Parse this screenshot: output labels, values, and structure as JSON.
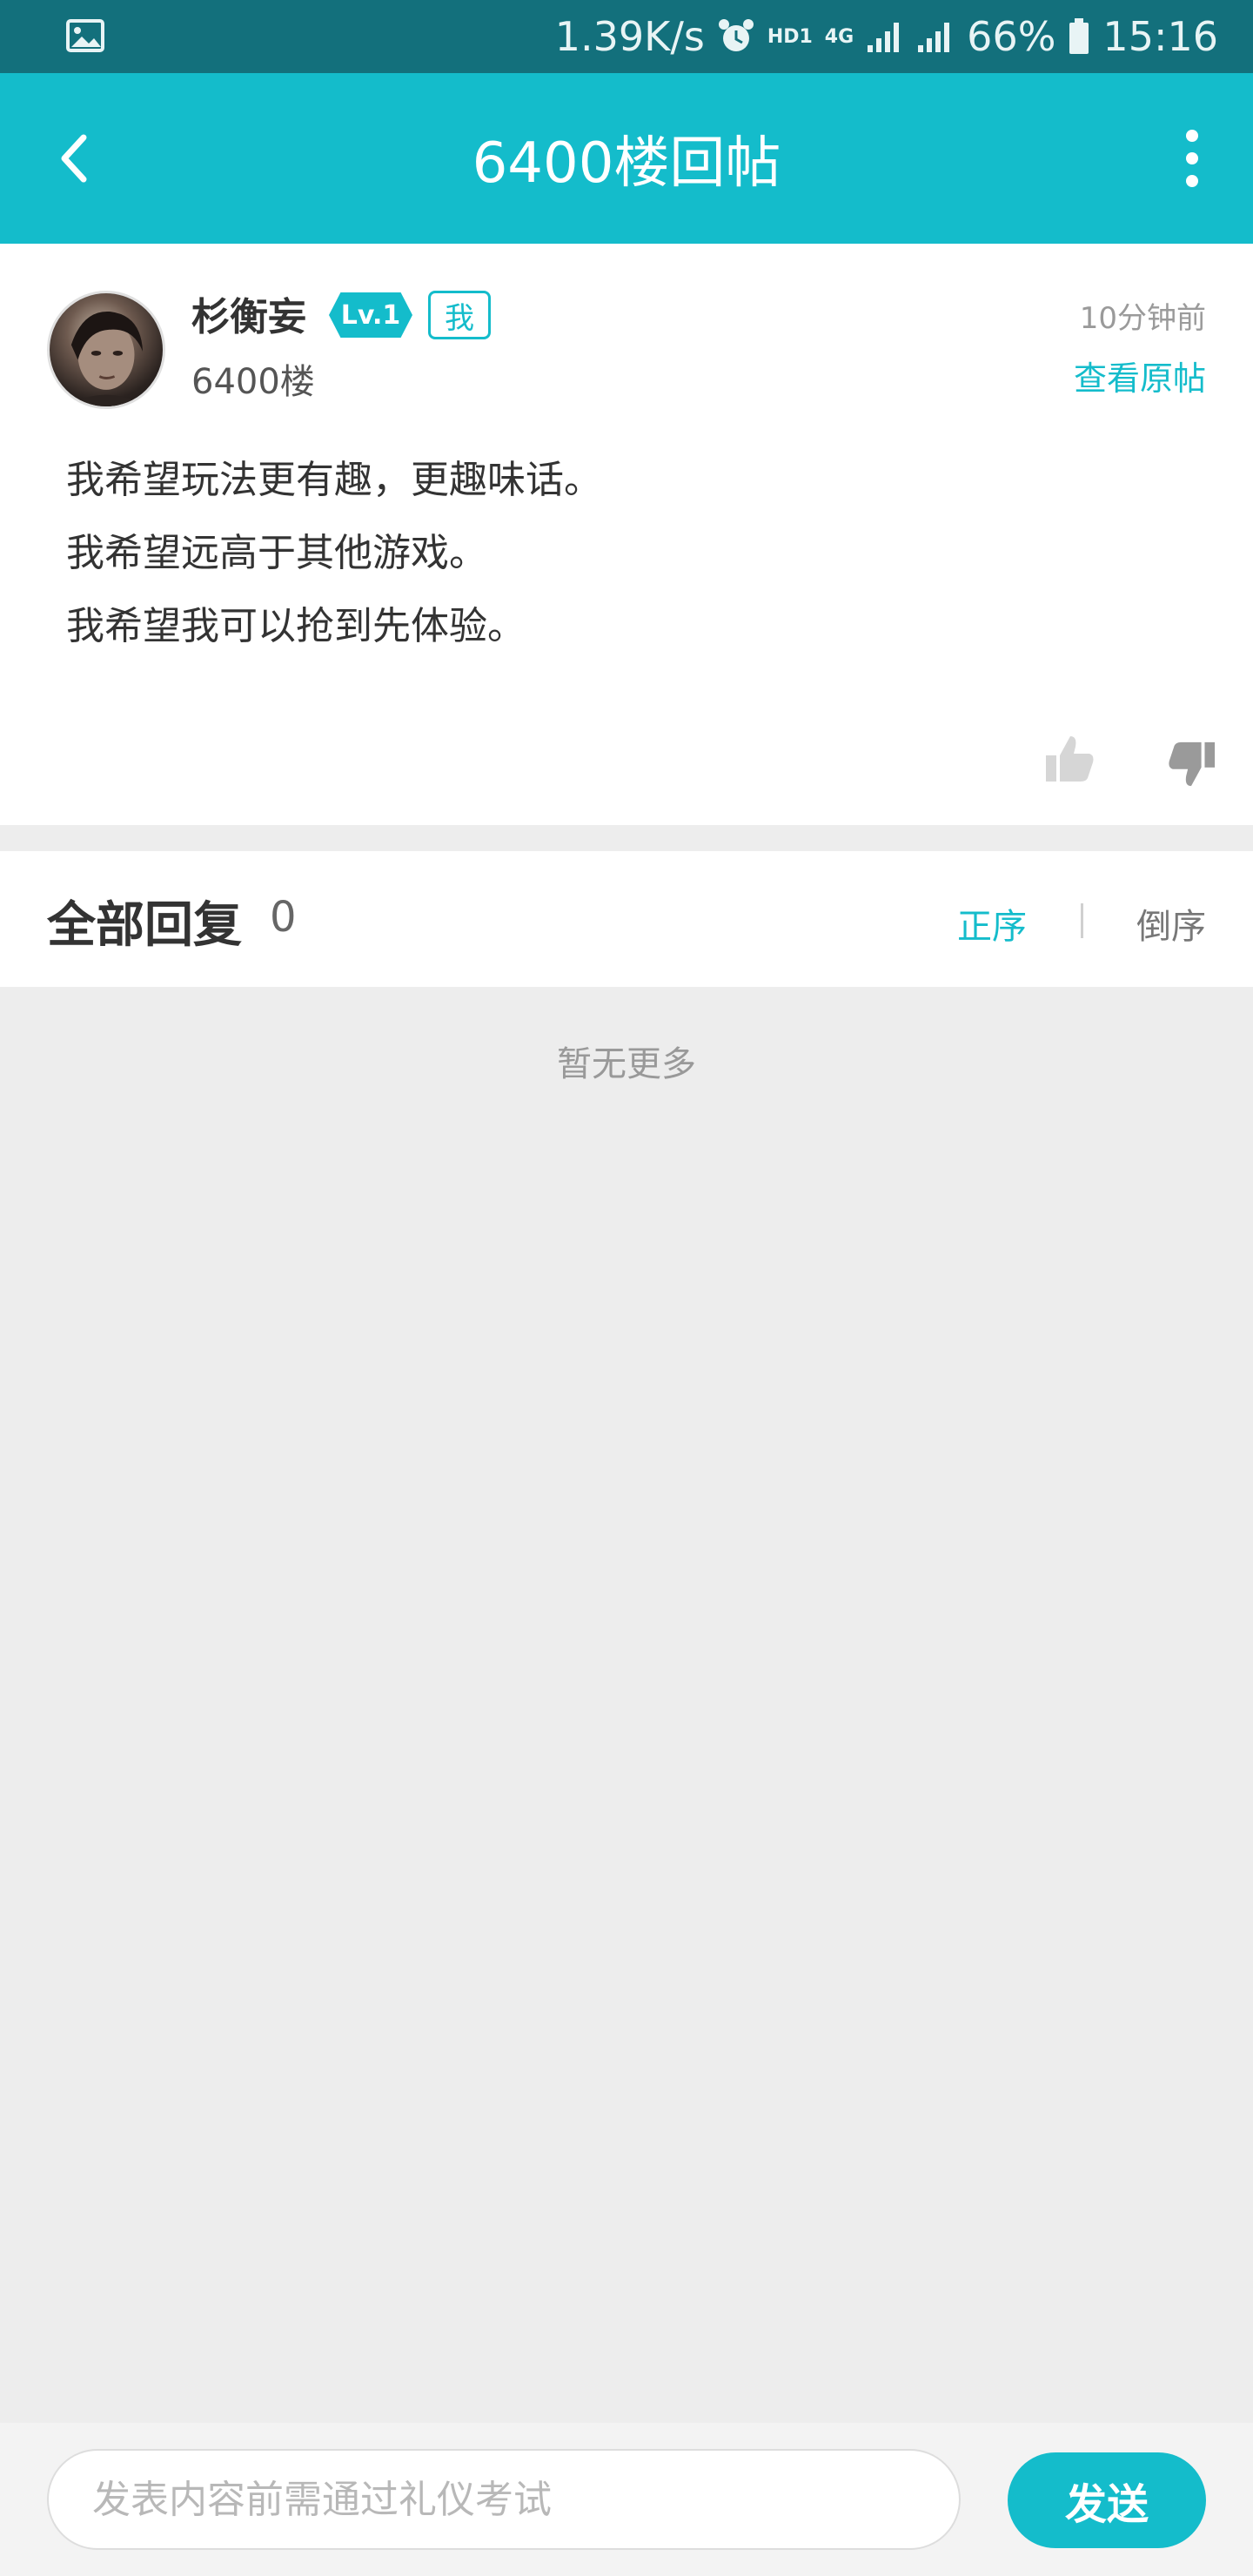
{
  "status_bar": {
    "net_speed": "1.39K/s",
    "hd": "HD1",
    "network": "4G",
    "battery": "66%",
    "time": "15:16",
    "icons": [
      "gallery-icon",
      "alarm-icon",
      "signal-icon",
      "battery-icon"
    ]
  },
  "header": {
    "title": "6400楼回帖"
  },
  "post": {
    "username": "杉衡妄",
    "level_badge": "Lv.1",
    "me_badge": "我",
    "floor": "6400楼",
    "time": "10分钟前",
    "view_original": "查看原帖",
    "lines": [
      "我希望玩法更有趣，更趣味话。",
      "我希望远高于其他游戏。",
      "我希望我可以抢到先体验。"
    ]
  },
  "replies": {
    "title": "全部回复",
    "count": "0",
    "sort_asc": "正序",
    "sort_desc": "倒序",
    "empty_text": "暂无更多"
  },
  "bottom_bar": {
    "input_placeholder": "发表内容前需通过礼仪考试",
    "send_label": "发送"
  },
  "colors": {
    "accent": "#14bccb",
    "status_bar": "#13707c",
    "background": "#ededed"
  }
}
